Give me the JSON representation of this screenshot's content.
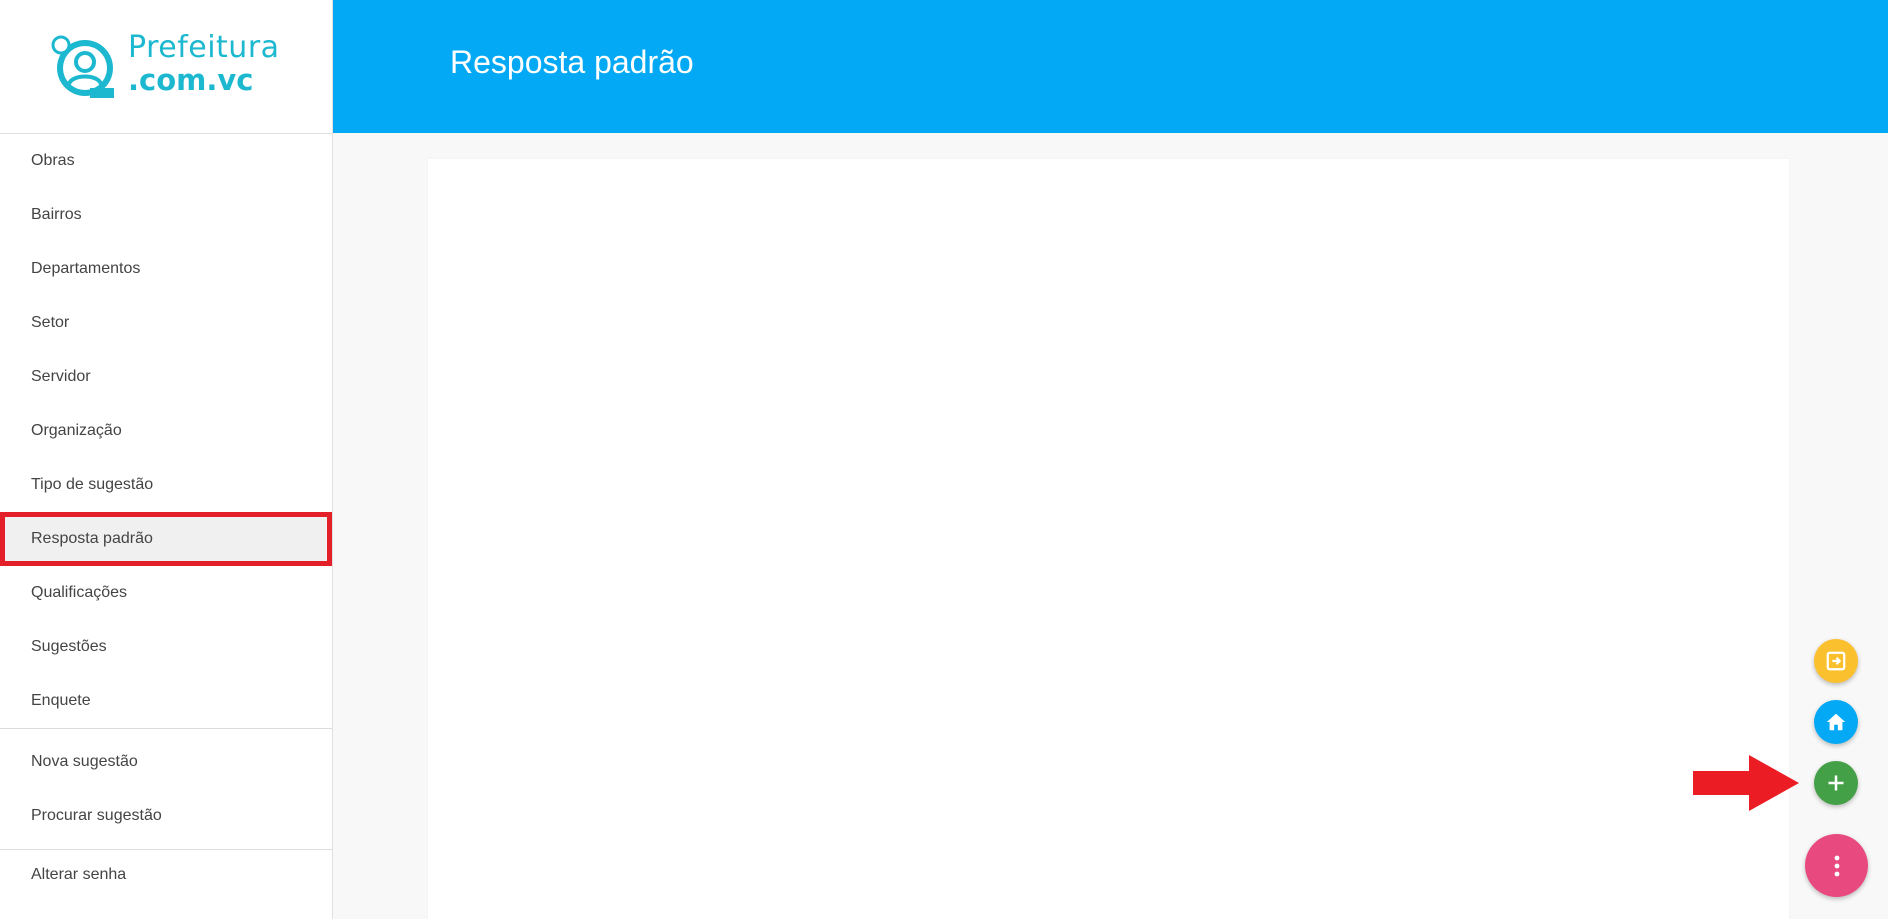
{
  "brand": {
    "name_line1": "Prefeitura",
    "name_line2": ".com.vc",
    "color": "#1bb8cf"
  },
  "sidebar": {
    "main_items": [
      {
        "label": "Obras"
      },
      {
        "label": "Bairros"
      },
      {
        "label": "Departamentos"
      },
      {
        "label": "Setor"
      },
      {
        "label": "Servidor"
      },
      {
        "label": "Organização"
      },
      {
        "label": "Tipo de sugestão"
      },
      {
        "label": "Resposta padrão",
        "active": true
      },
      {
        "label": "Qualificações"
      },
      {
        "label": "Sugestões"
      },
      {
        "label": "Enquete"
      }
    ],
    "action_items": [
      {
        "label": "Nova sugestão"
      },
      {
        "label": "Procurar sugestão"
      }
    ],
    "account_items": [
      {
        "label": "Alterar senha"
      }
    ]
  },
  "header": {
    "title": "Resposta padrão",
    "color": "#03a9f4"
  },
  "fab": {
    "exit": {
      "icon": "exit-to-app-icon",
      "color": "#fbc02d"
    },
    "home": {
      "icon": "home-icon",
      "color": "#03a9f4"
    },
    "add": {
      "icon": "plus-icon",
      "color": "#43a047"
    },
    "menu": {
      "icon": "more-vertical-icon",
      "color": "#e84a7f"
    }
  },
  "annotation": {
    "arrow_icon": "red-arrow-icon",
    "highlight_color": "#e3202a"
  }
}
